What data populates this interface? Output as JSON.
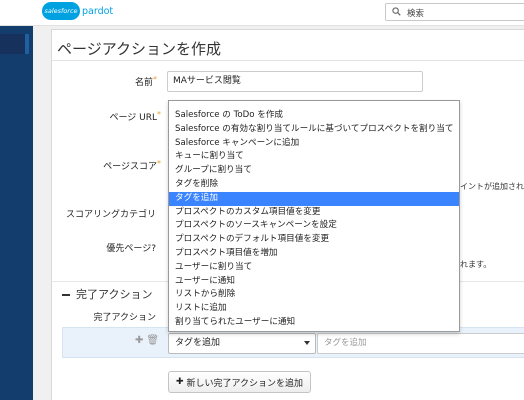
{
  "header": {
    "logo_brand": "salesforce",
    "logo_product": "pardot",
    "search_placeholder": "検索"
  },
  "page": {
    "title": "ページアクションを作成"
  },
  "form": {
    "name_label": "名前",
    "name_value": "MAサービス閲覧",
    "page_url_label": "ページ URL",
    "page_score_label": "ページスコア",
    "scoring_category_label": "スコアリングカテゴリ",
    "priority_page_label": "優先ページ?",
    "score_note_partial": "イントが追加されま",
    "priority_note_partial": "れます。"
  },
  "completion": {
    "section_title": "完了アクション",
    "row_label": "完了アクション",
    "selected_action": "タグを追加",
    "tag_placeholder": "タグを追加",
    "add_button_label": "新しい完了アクションを追加",
    "add_button_icon": "plus-icon"
  },
  "dropdown": {
    "selected_index": 7,
    "options": [
      "",
      "Salesforce の ToDo を作成",
      "Salesforce の有効な割り当てルールに基づいてプロスペクトを割り当て",
      "Salesforce キャンペーンに追加",
      "キューに割り当て",
      "グループに割り当て",
      "タグを削除",
      "タグを追加",
      "プロスペクトのカスタム項目値を変更",
      "プロスペクトのソースキャンペーンを設定",
      "プロスペクトのデフォルト項目値を変更",
      "プロスペクト項目値を増加",
      "ユーザーに割り当て",
      "ユーザーに通知",
      "リストから削除",
      "リストに追加",
      "割り当てられたユーザーに通知"
    ]
  },
  "colors": {
    "brand_blue": "#00a1e0",
    "rail": "#123d6d",
    "selected_option": "#3b84ff",
    "required_marker": "#e8a33c"
  }
}
